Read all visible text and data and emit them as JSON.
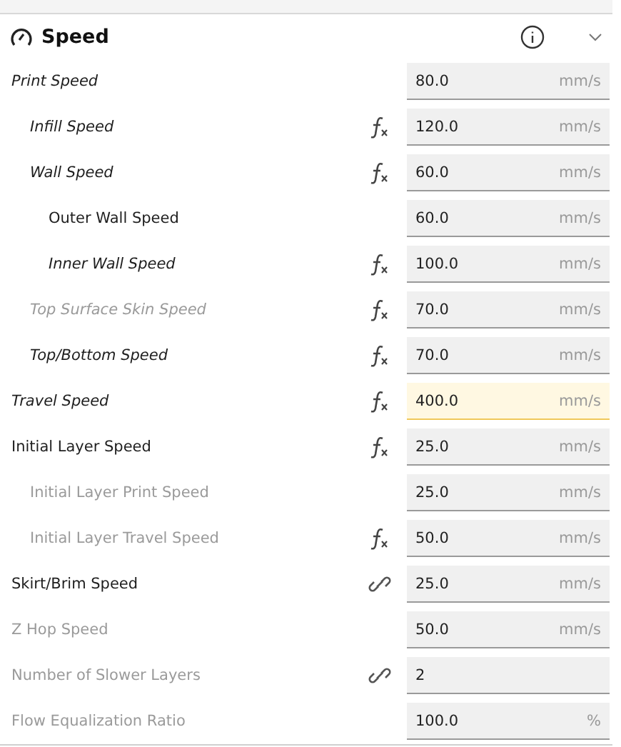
{
  "section": {
    "title": "Speed"
  },
  "settings": [
    {
      "label": "Print Speed",
      "overridden": true,
      "disabled": false,
      "formula": false,
      "linked": false,
      "value": "80.0",
      "unit": "mm/s",
      "highlighted": false,
      "children": [
        {
          "label": "Infill Speed",
          "overridden": true,
          "disabled": false,
          "formula": true,
          "linked": false,
          "value": "120.0",
          "unit": "mm/s",
          "highlighted": false
        },
        {
          "label": "Wall Speed",
          "overridden": true,
          "disabled": false,
          "formula": true,
          "linked": false,
          "value": "60.0",
          "unit": "mm/s",
          "highlighted": false,
          "children": [
            {
              "label": "Outer Wall Speed",
              "overridden": false,
              "disabled": false,
              "formula": false,
              "linked": false,
              "value": "60.0",
              "unit": "mm/s",
              "highlighted": false
            },
            {
              "label": "Inner Wall Speed",
              "overridden": true,
              "disabled": false,
              "formula": true,
              "linked": false,
              "value": "100.0",
              "unit": "mm/s",
              "highlighted": false
            }
          ]
        },
        {
          "label": "Top Surface Skin Speed",
          "overridden": true,
          "disabled": true,
          "formula": true,
          "linked": false,
          "value": "70.0",
          "unit": "mm/s",
          "highlighted": false
        },
        {
          "label": "Top/Bottom Speed",
          "overridden": true,
          "disabled": false,
          "formula": true,
          "linked": false,
          "value": "70.0",
          "unit": "mm/s",
          "highlighted": false
        }
      ]
    },
    {
      "label": "Travel Speed",
      "overridden": true,
      "disabled": false,
      "formula": true,
      "linked": false,
      "value": "400.0",
      "unit": "mm/s",
      "highlighted": true
    },
    {
      "label": "Initial Layer Speed",
      "overridden": false,
      "disabled": false,
      "formula": true,
      "linked": false,
      "value": "25.0",
      "unit": "mm/s",
      "highlighted": false,
      "children": [
        {
          "label": "Initial Layer Print Speed",
          "overridden": false,
          "disabled": true,
          "formula": false,
          "linked": false,
          "value": "25.0",
          "unit": "mm/s",
          "highlighted": false
        },
        {
          "label": "Initial Layer Travel Speed",
          "overridden": false,
          "disabled": true,
          "formula": true,
          "linked": false,
          "value": "50.0",
          "unit": "mm/s",
          "highlighted": false
        }
      ]
    },
    {
      "label": "Skirt/Brim Speed",
      "overridden": false,
      "disabled": false,
      "formula": false,
      "linked": true,
      "value": "25.0",
      "unit": "mm/s",
      "highlighted": false
    },
    {
      "label": "Z Hop Speed",
      "overridden": false,
      "disabled": true,
      "formula": false,
      "linked": false,
      "value": "50.0",
      "unit": "mm/s",
      "highlighted": false
    },
    {
      "label": "Number of Slower Layers",
      "overridden": false,
      "disabled": true,
      "formula": false,
      "linked": true,
      "value": "2",
      "highlighted": false
    },
    {
      "label": "Flow Equalization Ratio",
      "overridden": false,
      "disabled": true,
      "formula": false,
      "linked": false,
      "value": "100.0",
      "unit": "%",
      "highlighted": false
    }
  ]
}
